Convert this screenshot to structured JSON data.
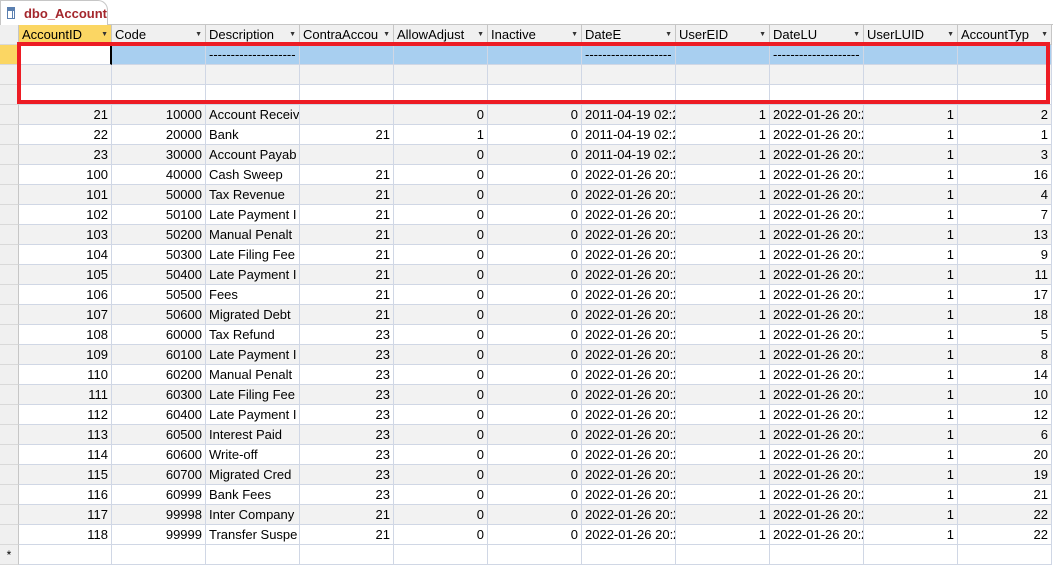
{
  "tab": {
    "title": "dbo_Account",
    "icon": "table-icon"
  },
  "columns": [
    "AccountID",
    "Code",
    "Description",
    "ContraAccou",
    "AllowAdjust",
    "Inactive",
    "DateE",
    "UserEID",
    "DateLU",
    "UserLUID",
    "AccountTyp"
  ],
  "blank_row_dashes": [
    "",
    "",
    "--------------------",
    "",
    "",
    "",
    "--------------------",
    "",
    "--------------------",
    "",
    ""
  ],
  "new_row_marker": "*",
  "rows": [
    [
      "21",
      "10000",
      "Account Receiv",
      "",
      "0",
      "0",
      "2011-04-19 02:2",
      "1",
      "2022-01-26 20:2",
      "1",
      "2"
    ],
    [
      "22",
      "20000",
      "Bank",
      "21",
      "1",
      "0",
      "2011-04-19 02:2",
      "1",
      "2022-01-26 20:2",
      "1",
      "1"
    ],
    [
      "23",
      "30000",
      "Account Payab",
      "",
      "0",
      "0",
      "2011-04-19 02:2",
      "1",
      "2022-01-26 20:2",
      "1",
      "3"
    ],
    [
      "100",
      "40000",
      "Cash Sweep",
      "21",
      "0",
      "0",
      "2022-01-26 20:2",
      "1",
      "2022-01-26 20:2",
      "1",
      "16"
    ],
    [
      "101",
      "50000",
      "Tax Revenue",
      "21",
      "0",
      "0",
      "2022-01-26 20:2",
      "1",
      "2022-01-26 20:2",
      "1",
      "4"
    ],
    [
      "102",
      "50100",
      "Late Payment I",
      "21",
      "0",
      "0",
      "2022-01-26 20:2",
      "1",
      "2022-01-26 20:2",
      "1",
      "7"
    ],
    [
      "103",
      "50200",
      "Manual Penalt",
      "21",
      "0",
      "0",
      "2022-01-26 20:2",
      "1",
      "2022-01-26 20:2",
      "1",
      "13"
    ],
    [
      "104",
      "50300",
      "Late Filing Fee",
      "21",
      "0",
      "0",
      "2022-01-26 20:2",
      "1",
      "2022-01-26 20:2",
      "1",
      "9"
    ],
    [
      "105",
      "50400",
      "Late Payment I",
      "21",
      "0",
      "0",
      "2022-01-26 20:2",
      "1",
      "2022-01-26 20:2",
      "1",
      "11"
    ],
    [
      "106",
      "50500",
      "Fees",
      "21",
      "0",
      "0",
      "2022-01-26 20:2",
      "1",
      "2022-01-26 20:2",
      "1",
      "17"
    ],
    [
      "107",
      "50600",
      "Migrated Debt",
      "21",
      "0",
      "0",
      "2022-01-26 20:2",
      "1",
      "2022-01-26 20:2",
      "1",
      "18"
    ],
    [
      "108",
      "60000",
      "Tax Refund",
      "23",
      "0",
      "0",
      "2022-01-26 20:2",
      "1",
      "2022-01-26 20:2",
      "1",
      "5"
    ],
    [
      "109",
      "60100",
      "Late Payment I",
      "23",
      "0",
      "0",
      "2022-01-26 20:2",
      "1",
      "2022-01-26 20:2",
      "1",
      "8"
    ],
    [
      "110",
      "60200",
      "Manual Penalt",
      "23",
      "0",
      "0",
      "2022-01-26 20:2",
      "1",
      "2022-01-26 20:2",
      "1",
      "14"
    ],
    [
      "111",
      "60300",
      "Late Filing Fee",
      "23",
      "0",
      "0",
      "2022-01-26 20:2",
      "1",
      "2022-01-26 20:2",
      "1",
      "10"
    ],
    [
      "112",
      "60400",
      "Late Payment I",
      "23",
      "0",
      "0",
      "2022-01-26 20:2",
      "1",
      "2022-01-26 20:2",
      "1",
      "12"
    ],
    [
      "113",
      "60500",
      "Interest Paid",
      "23",
      "0",
      "0",
      "2022-01-26 20:2",
      "1",
      "2022-01-26 20:2",
      "1",
      "6"
    ],
    [
      "114",
      "60600",
      "Write-off",
      "23",
      "0",
      "0",
      "2022-01-26 20:2",
      "1",
      "2022-01-26 20:2",
      "1",
      "20"
    ],
    [
      "115",
      "60700",
      "Migrated Cred",
      "23",
      "0",
      "0",
      "2022-01-26 20:2",
      "1",
      "2022-01-26 20:2",
      "1",
      "19"
    ],
    [
      "116",
      "60999",
      "Bank Fees",
      "23",
      "0",
      "0",
      "2022-01-26 20:2",
      "1",
      "2022-01-26 20:2",
      "1",
      "21"
    ],
    [
      "117",
      "99998",
      "Inter Company",
      "21",
      "0",
      "0",
      "2022-01-26 20:2",
      "1",
      "2022-01-26 20:2",
      "1",
      "22"
    ],
    [
      "118",
      "99999",
      "Transfer Suspe",
      "21",
      "0",
      "0",
      "2022-01-26 20:2",
      "1",
      "2022-01-26 20:2",
      "1",
      "22"
    ]
  ]
}
